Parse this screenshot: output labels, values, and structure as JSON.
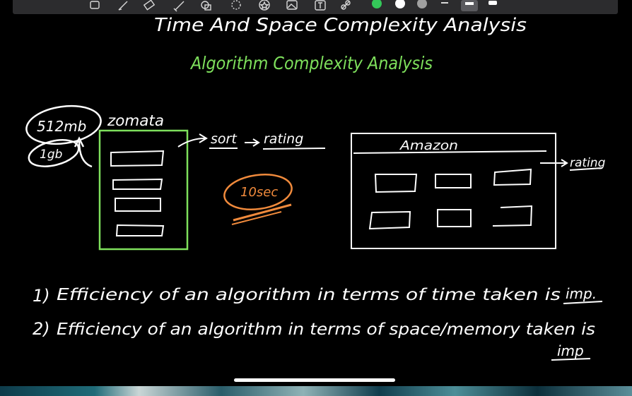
{
  "toolbar": {
    "tools": [
      "lasso-icon",
      "pen-icon",
      "eraser-icon",
      "highlighter-icon",
      "shapes-icon",
      "lasso-select-icon",
      "star-icon",
      "image-icon",
      "text-icon",
      "link-icon"
    ],
    "colors": [
      "#34c759",
      "#ffffff",
      "#a0a0a0",
      "#ffffff"
    ]
  },
  "note": {
    "title": "Time And Space Complexity Analysis",
    "subtitle": "Algorithm Complexity Analysis",
    "zomato": {
      "label": "zomata",
      "memory_top": "512mb",
      "memory_bottom": "1gb",
      "sort_label": "sort",
      "rating_label": "rating",
      "count_label": "10sec"
    },
    "amazon": {
      "label": "Amazon",
      "rating_label": "rating"
    },
    "points": [
      {
        "num": "1)",
        "text": "Efficiency of an algorithm in terms of time taken is",
        "emph": "imp."
      },
      {
        "num": "2)",
        "text": "Efficiency of an algorithm in terms of space/memory taken is",
        "emph": "imp"
      }
    ]
  },
  "colors": {
    "green": "#7ee05c",
    "orange": "#f08a3c",
    "ink": "#ffffff"
  }
}
